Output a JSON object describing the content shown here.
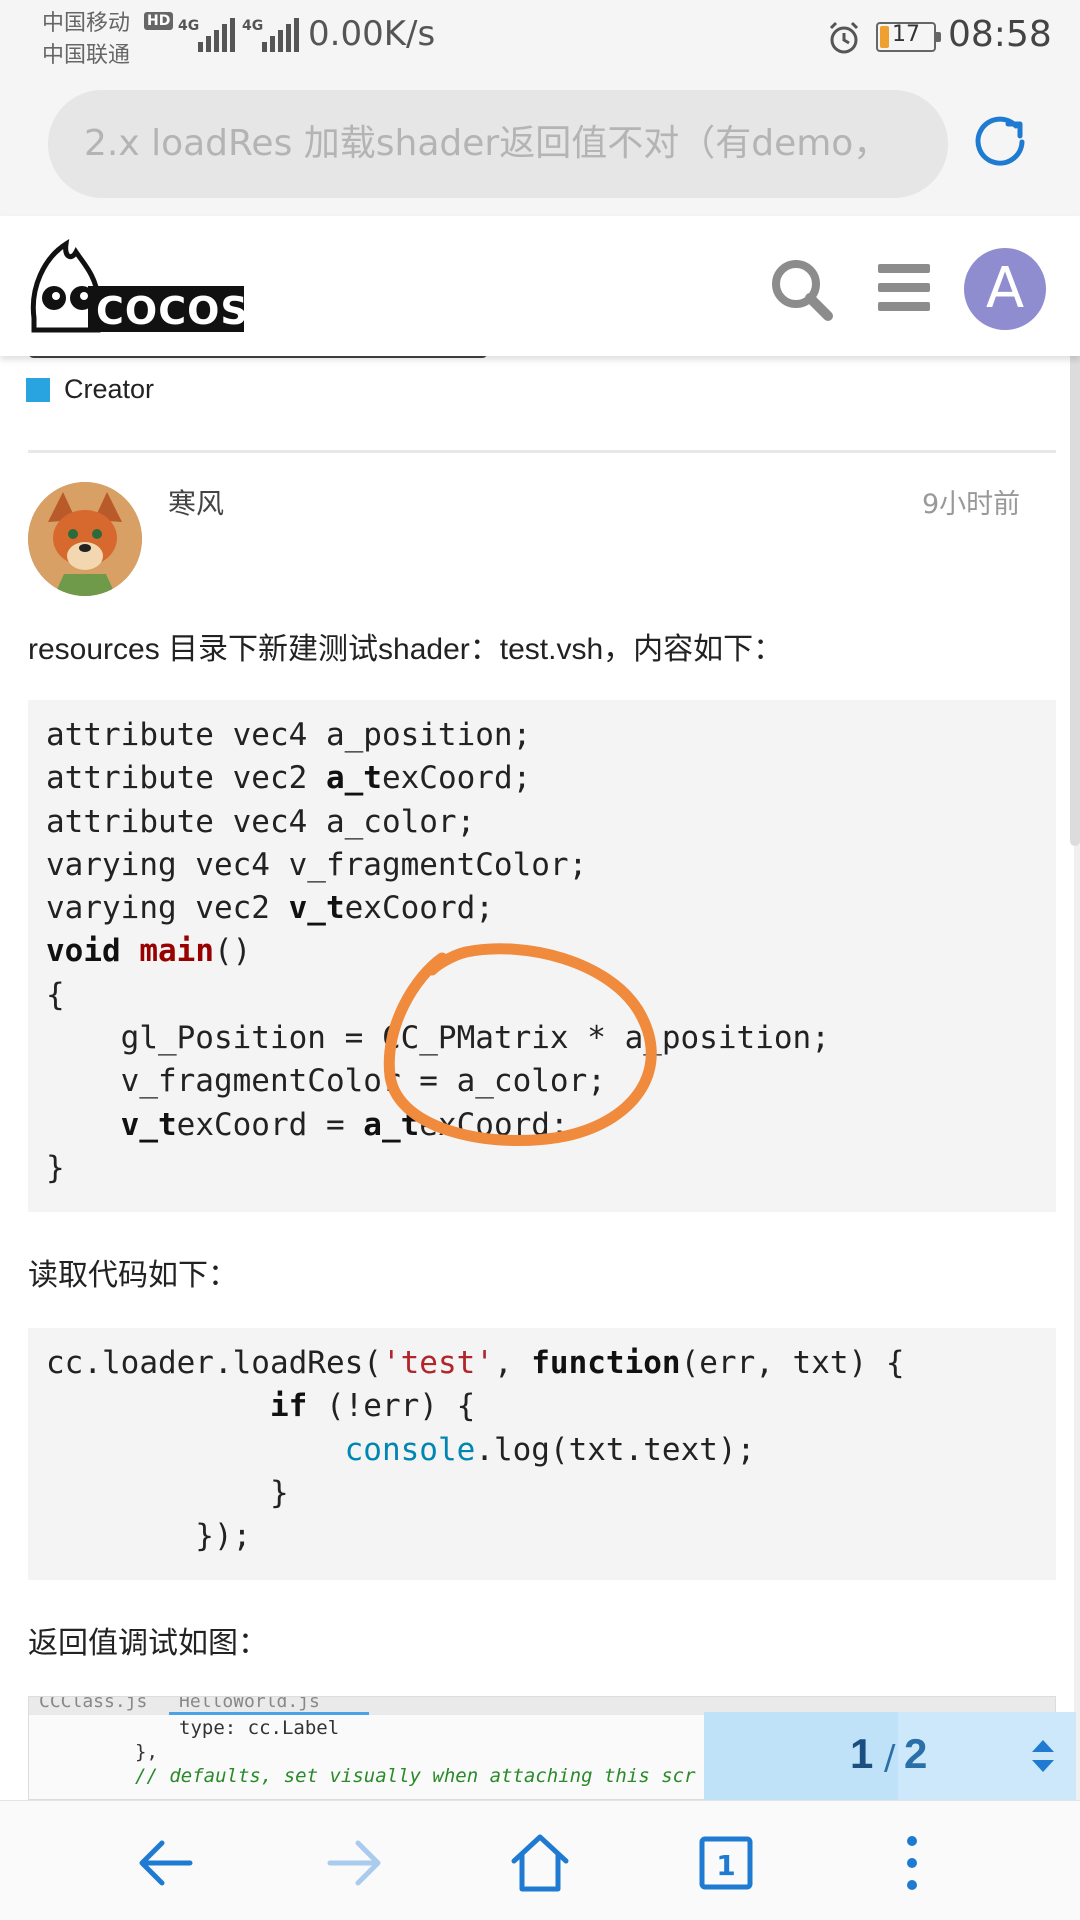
{
  "status_bar": {
    "carrier_1": "中国移动",
    "carrier_2": "中国联通",
    "hd_badge": "HD",
    "network_1": "4G",
    "network_2": "4G",
    "net_speed": "0.00K/s",
    "battery_level": "17",
    "battery_fraction": 0.17,
    "time": "08:58"
  },
  "browser": {
    "url_text": "2.x loadRes 加载shader返回值不对（有demo，",
    "reload_icon": "reload-icon"
  },
  "site_header": {
    "logo_text": "COCOS",
    "search_icon": "search-icon",
    "menu_icon": "hamburger-menu-icon",
    "avatar_letter": "A",
    "avatar_color": "#8f8ccf"
  },
  "topic": {
    "category": "Creator",
    "category_color": "#2aa4e0"
  },
  "post": {
    "author": "寒风",
    "time": "9小时前",
    "intro": "resources 目录下新建测试shader：test.vsh，内容如下：",
    "read_code_label": "读取代码如下：",
    "return_value_label": "返回值调试如图："
  },
  "screenshot_preview": {
    "tab_1": "CCClass.js",
    "tab_2": "HelloWorld.js",
    "line_1": "type: cc.Label",
    "line_2": "},",
    "line_3": "// defaults, set visually when attaching this scr"
  },
  "pager": {
    "current": "1",
    "separator": "/",
    "total": "2"
  },
  "bottom_nav": {
    "items": [
      "back-arrow-icon",
      "forward-arrow-icon",
      "home-icon",
      "tabs-icon",
      "more-icon"
    ],
    "tabs_count": "1"
  },
  "colors": {
    "accent_orange": "#f08a3c",
    "link_blue": "#1f7bd1"
  }
}
